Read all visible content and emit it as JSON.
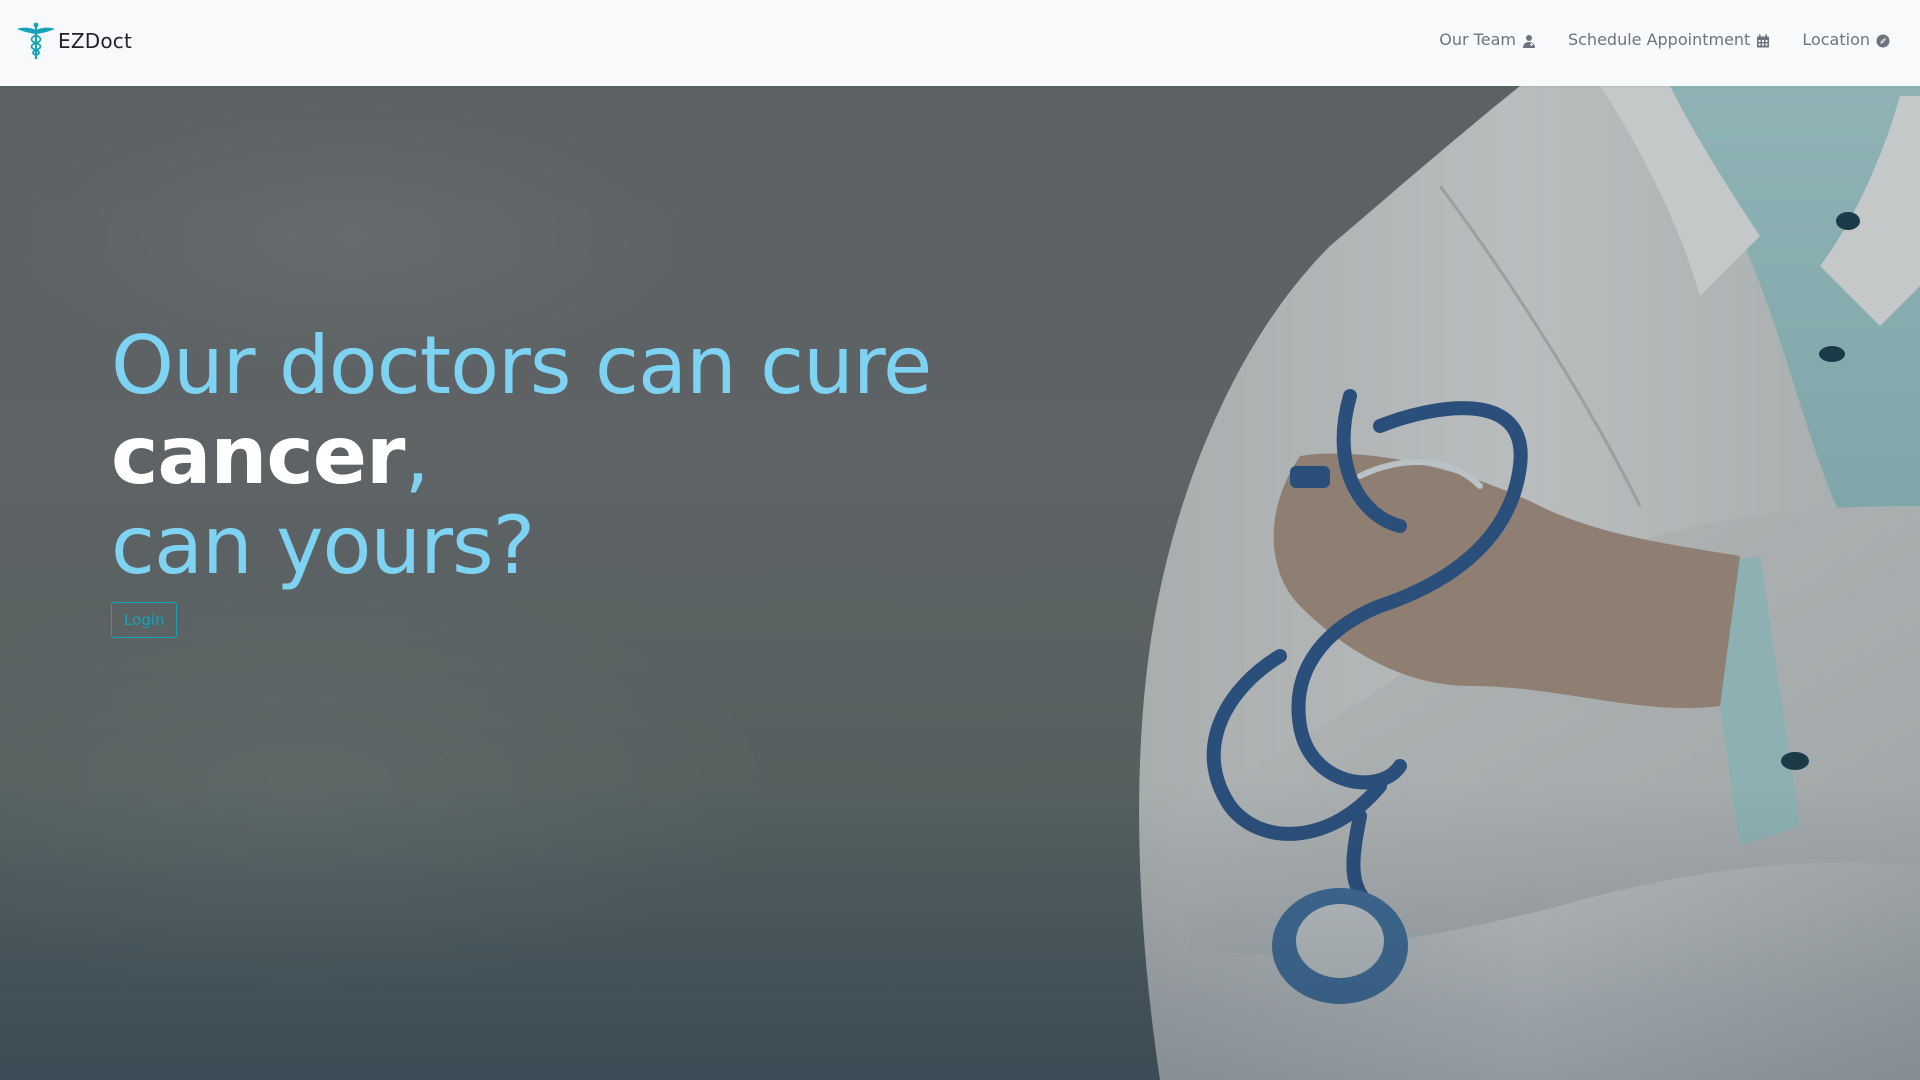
{
  "brand": {
    "name": "EZDoct",
    "logo_icon": "caduceus-icon",
    "logo_color": "#17a2b8"
  },
  "nav": {
    "items": [
      {
        "label": "Our Team",
        "icon": "user-doctor-icon"
      },
      {
        "label": "Schedule Appointment",
        "icon": "calendar-icon"
      },
      {
        "label": "Location",
        "icon": "compass-icon"
      }
    ]
  },
  "hero": {
    "line1": "Our doctors can cure",
    "line2_strong": "cancer",
    "line2_punct": ",",
    "line3": "can yours?",
    "login_label": "Login",
    "accent_color": "#7fd3f2",
    "button_color": "#17a2b8",
    "background_image": "doctor-with-stethoscope-photo"
  }
}
